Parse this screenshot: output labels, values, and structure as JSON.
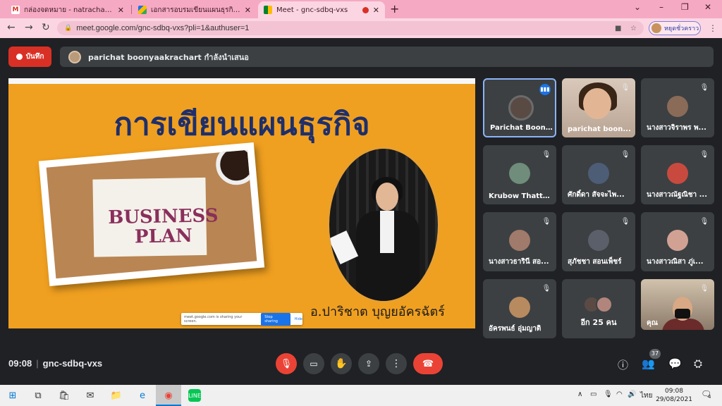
{
  "browser": {
    "tabs": [
      {
        "title": "กล่องจดหมาย - natracha@pttc.ac.th",
        "icon": "gmail-icon",
        "color": "#d93025"
      },
      {
        "title": "เอกสารอบรมเขียนแผนธุรกิจออนไลน์ ปี",
        "icon": "drive-icon",
        "color": "#1a73e8"
      },
      {
        "title": "Meet - gnc-sdbq-vxs",
        "icon": "meet-icon",
        "color": "#00832d"
      }
    ],
    "close_glyph": "✕",
    "new_tab": "+",
    "url": "meet.google.com/gnc-sdbq-vxs?pli=1&authuser=1",
    "profile_label": "หยุดชั่วคราว"
  },
  "meet": {
    "record_label": "บันทึก",
    "presenter_banner": "parichat boonyaakrachart กำลังนำเสนอ",
    "slide": {
      "title": "การเขียนแผนธุรกิจ",
      "image_text_line1": "BUSINESS",
      "image_text_line2": "PLAN",
      "presenter_name": "อ.ปาริชาต  บุญยอัครฉัตร์",
      "share_notice": "meet.google.com is sharing your screen.",
      "stop_sharing": "Stop sharing",
      "hide": "Hide"
    },
    "participants": [
      {
        "name": "Parichat Boony...",
        "speaking": true
      },
      {
        "name": "parichat boon...",
        "video": true
      },
      {
        "name": "นางสาวจิราพร พ..."
      },
      {
        "name": "Krubow Thatth..."
      },
      {
        "name": "ศักดิ์ดา สัจจะไพ..."
      },
      {
        "name": "นางสาวณัฐณิชา ..."
      },
      {
        "name": "นางสาวธารินี สอ..."
      },
      {
        "name": "สุภัชชา สอนเพ็ชร์"
      },
      {
        "name": "นางสาวณิสา ภู่เ..."
      },
      {
        "name": "อัครพนธ์ อุ่มญาติ"
      },
      {
        "name": "อีก 25 คน",
        "more": true
      },
      {
        "name": "คุณ",
        "video": true
      }
    ],
    "time": "09:08",
    "meeting_code": "gnc-sdbq-vxs",
    "people_count": "37"
  },
  "taskbar": {
    "time": "09:08",
    "date": "29/08/2021",
    "lang": "ไทย",
    "notification_count": "4"
  }
}
